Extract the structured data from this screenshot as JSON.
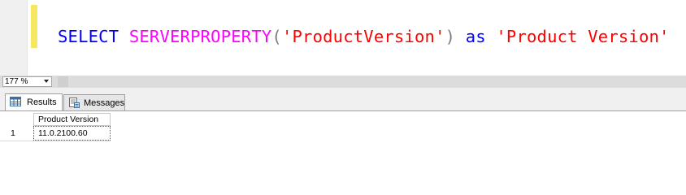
{
  "editor": {
    "query_tokens": [
      {
        "text": "SELECT",
        "kind": "kw"
      },
      {
        "text": " ",
        "kind": "pn"
      },
      {
        "text": "SERVERPROPERTY",
        "kind": "fn"
      },
      {
        "text": "(",
        "kind": "pn"
      },
      {
        "text": "'ProductVersion'",
        "kind": "str"
      },
      {
        "text": ")",
        "kind": "pn"
      },
      {
        "text": " ",
        "kind": "pn"
      },
      {
        "text": "as",
        "kind": "kw"
      },
      {
        "text": " ",
        "kind": "pn"
      },
      {
        "text": "'Product Version'",
        "kind": "str"
      }
    ],
    "colors": {
      "keyword": "#0000ff",
      "function": "#ff00ff",
      "punctuation": "#808080",
      "string": "#ff0000",
      "change_marker": "#f7e660"
    }
  },
  "zoom": {
    "value": "177 %"
  },
  "tabs": [
    {
      "label": "Results",
      "icon": "grid-results-icon",
      "active": true
    },
    {
      "label": "Messages",
      "icon": "messages-icon",
      "active": false
    }
  ],
  "results": {
    "columns": [
      "Product Version"
    ],
    "rows": [
      {
        "row_number": "1",
        "cells": [
          "11.0.2100.60"
        ]
      }
    ]
  }
}
